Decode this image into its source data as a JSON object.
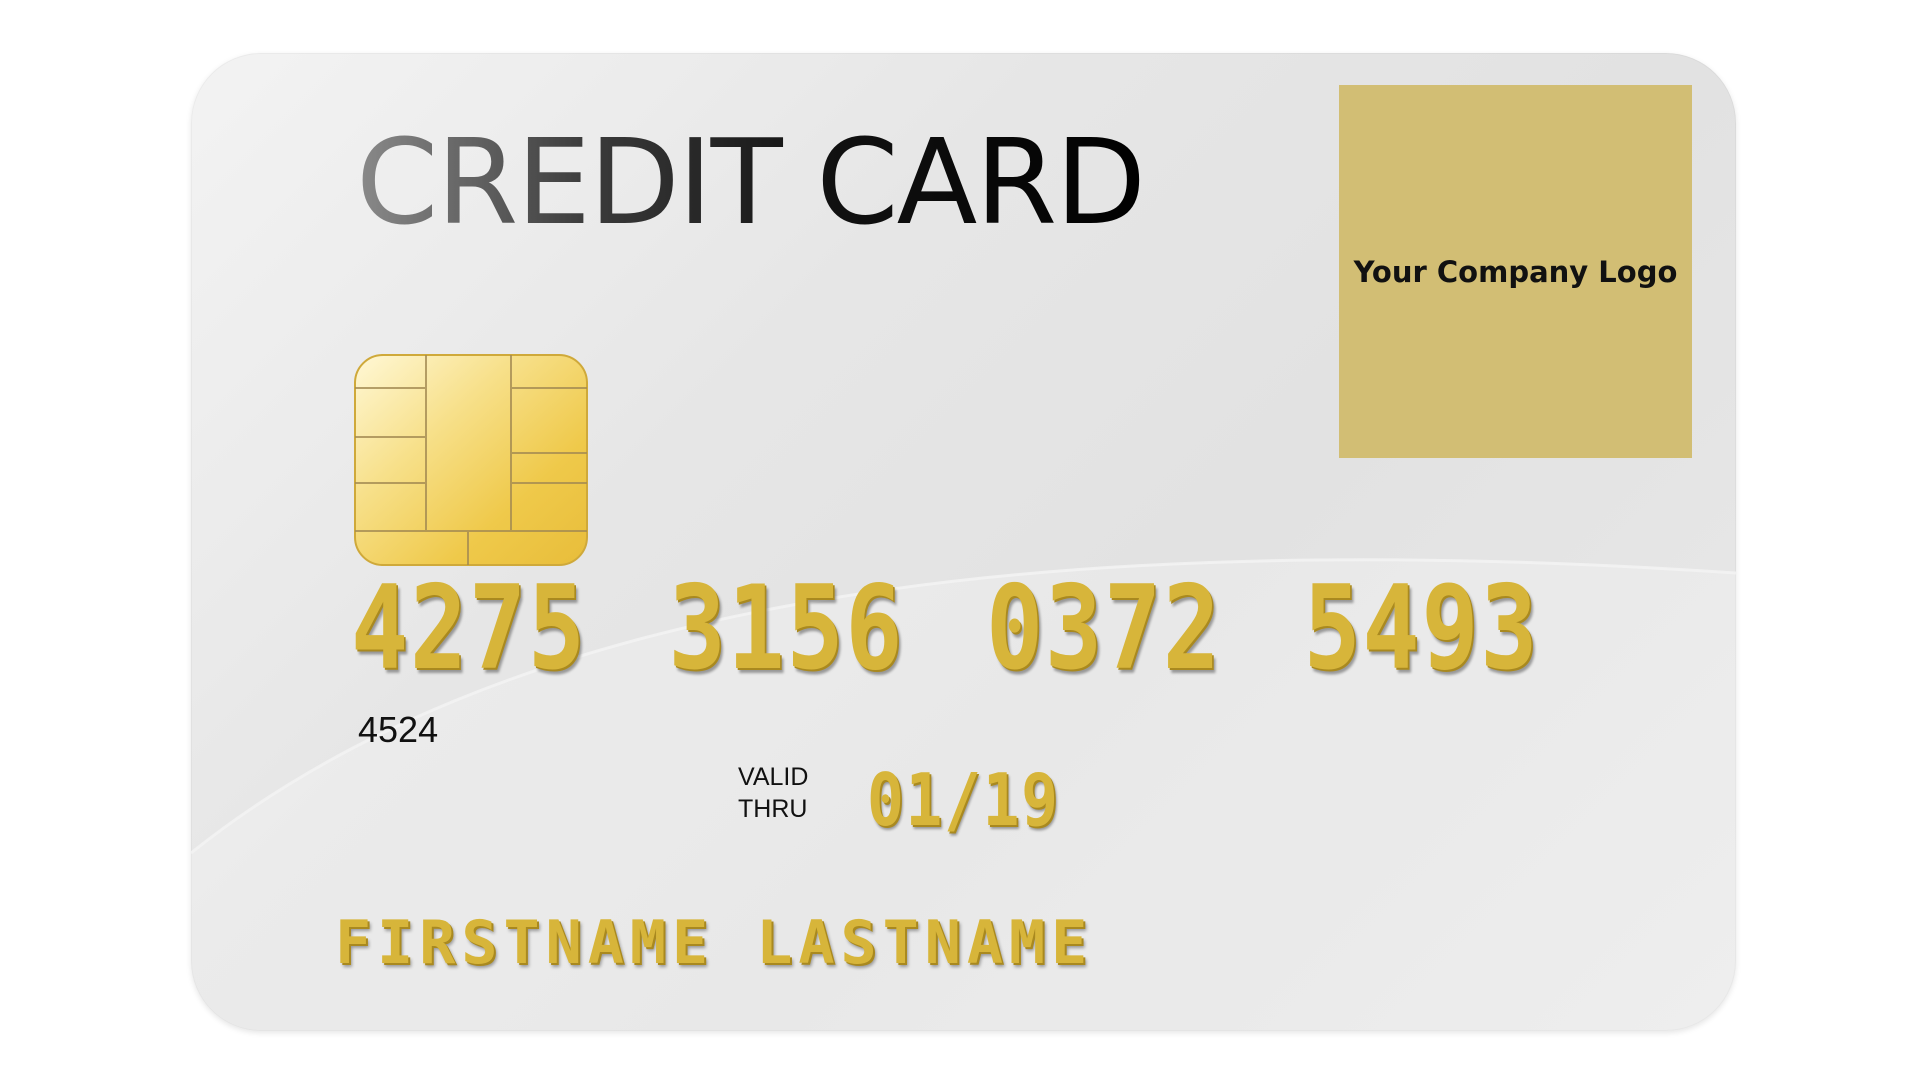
{
  "card": {
    "title": "CREDIT CARD",
    "logo_text": "Your Company Logo",
    "number_groups": [
      "4275",
      "3156",
      "0372",
      "5493"
    ],
    "small_code": "4524",
    "valid_label_line1": "VALID",
    "valid_label_line2": "THRU",
    "valid_date": "01/19",
    "holder_name": "FIRSTNAME LASTNAME"
  },
  "colors": {
    "card_background": "#e4e4e4",
    "logo_box": "#d2be74",
    "embossed_gold": "#d7b53a",
    "chip_gold": "#f0cf50"
  },
  "icons": {
    "chip": "emv-chip-icon"
  }
}
